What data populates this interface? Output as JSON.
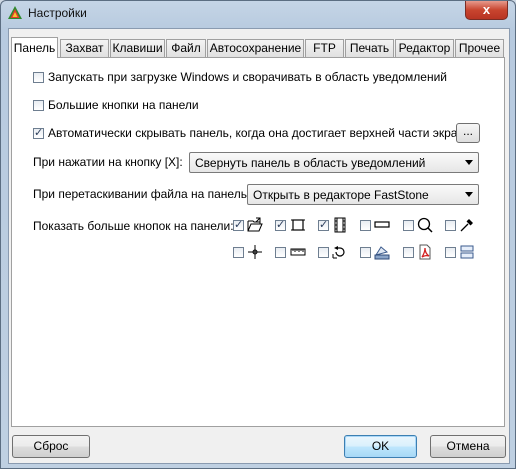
{
  "window": {
    "title": "Настройки",
    "close_glyph": "x"
  },
  "tabs": [
    {
      "label": "Панель",
      "active": true
    },
    {
      "label": "Захват"
    },
    {
      "label": "Клавиши"
    },
    {
      "label": "Файл"
    },
    {
      "label": "Автосохранение"
    },
    {
      "label": "FTP"
    },
    {
      "label": "Печать"
    },
    {
      "label": "Редактор"
    },
    {
      "label": "Прочее"
    }
  ],
  "panel": {
    "options": [
      {
        "label": "Запускать при загрузке Windows и сворачивать в область уведомлений",
        "checked": false
      },
      {
        "label": "Большие кнопки на панели",
        "checked": false
      },
      {
        "label": "Автоматически скрывать панель, когда она достигает верхней части экрана",
        "checked": true
      }
    ],
    "dots_button": "...",
    "button_x_action": {
      "label": "При нажатии на кнопку [X]:",
      "value": "Свернуть панель в область уведомлений"
    },
    "drag_file_action": {
      "label": "При перетаскивании файла на панель:",
      "value": "Открыть в редакторе FastStone"
    },
    "more_buttons": {
      "label": "Показать больше кнопок на панели:",
      "items": [
        {
          "icon": "open-folder-icon",
          "checked": true
        },
        {
          "icon": "crop-frame-icon",
          "checked": true
        },
        {
          "icon": "film-strip-icon",
          "checked": true
        },
        {
          "icon": "horizontal-bar-icon",
          "checked": false
        },
        {
          "icon": "magnifier-icon",
          "checked": false
        },
        {
          "icon": "color-picker-icon",
          "checked": false
        },
        {
          "icon": "crosshair-icon",
          "checked": false
        },
        {
          "icon": "ruler-icon",
          "checked": false
        },
        {
          "icon": "undo-arrow-icon",
          "checked": false
        },
        {
          "icon": "scanner-icon",
          "checked": false
        },
        {
          "icon": "pdf-icon",
          "checked": false
        },
        {
          "icon": "split-window-icon",
          "checked": false
        }
      ]
    }
  },
  "footer": {
    "reset": "Сброс",
    "ok": "OK",
    "cancel": "Отмена"
  },
  "colors": {
    "frame": "#c5d5e6",
    "close": "#c8452f",
    "default_button": "#a7d9f5"
  }
}
